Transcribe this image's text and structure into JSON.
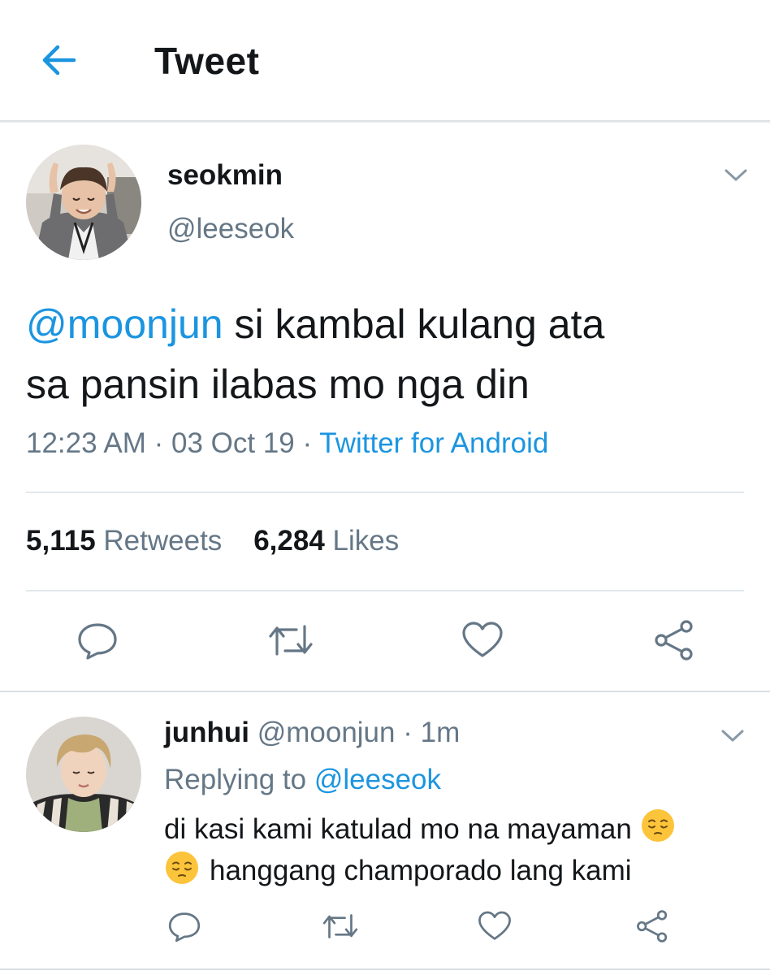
{
  "header": {
    "title": "Tweet",
    "back_icon": "arrow-left-icon"
  },
  "colors": {
    "accent": "#1b95e0",
    "secondary_text": "#657786",
    "primary_text": "#14171a",
    "divider": "#e1e8ed"
  },
  "tweet": {
    "author_name": "seokmin",
    "author_handle": "@leeseok",
    "mention": "@moonjun",
    "text_line1_rest": " si kambal kulang ata",
    "text_line2": "sa pansin ilabas mo nga din",
    "time": "12:23 AM",
    "separator": " · ",
    "date": "03 Oct 19",
    "source": "Twitter for Android",
    "retweet_count": "5,115",
    "retweet_label": "Retweets",
    "like_count": "6,284",
    "like_label": "Likes"
  },
  "reply": {
    "author_name": "junhui",
    "author_handle": "@moonjun",
    "time_ago": "1m",
    "replying_to_label": "Replying to ",
    "replying_to_handle": "@leeseok",
    "text_line1": "di kasi kami katulad mo na mayaman",
    "text_line2": "hanggang champorado lang kami",
    "emoji": "pensive-face-emoji"
  },
  "actions": [
    "reply-icon",
    "retweet-icon",
    "like-icon",
    "share-icon"
  ]
}
